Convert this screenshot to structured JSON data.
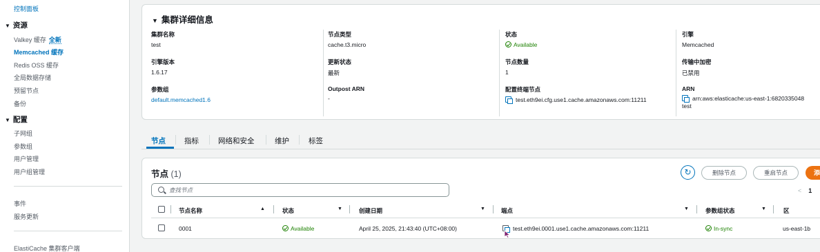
{
  "sidebar": {
    "top_link": "控制面板",
    "resources_header": "资源",
    "resource_items": [
      {
        "label": "Valkey 缓存",
        "badge": "全新"
      },
      {
        "label": "Memcached 缓存"
      },
      {
        "label": "Redis OSS 缓存"
      },
      {
        "label": "全局数据存储"
      },
      {
        "label": "预留节点"
      },
      {
        "label": "备份"
      }
    ],
    "config_header": "配置",
    "config_items": [
      "子网组",
      "参数组",
      "用户管理",
      "用户组管理"
    ],
    "other_items": [
      "事件",
      "服务更新"
    ],
    "footer_item": "ElastiCache 集群客户端"
  },
  "details": {
    "title": "集群详细信息",
    "fields": {
      "cluster_name": {
        "label": "集群名称",
        "value": "test"
      },
      "node_type": {
        "label": "节点类型",
        "value": "cache.t3.micro"
      },
      "status": {
        "label": "状态",
        "value": "Available"
      },
      "engine": {
        "label": "引擎",
        "value": "Memcached"
      },
      "engine_version": {
        "label": "引擎版本",
        "value": "1.6.17"
      },
      "update_status": {
        "label": "更新状态",
        "value": "最新"
      },
      "node_count": {
        "label": "节点数量",
        "value": "1"
      },
      "encryption": {
        "label": "传输中加密",
        "value": "已禁用"
      },
      "param_group": {
        "label": "参数组",
        "value": "default.memcached1.6"
      },
      "outpost_arn": {
        "label": "Outpost ARN",
        "value": "-"
      },
      "config_endpoint": {
        "label": "配置终端节点",
        "value": "test.eth9ei.cfg.use1.cache.amazonaws.com:11211"
      },
      "arn": {
        "label": "ARN",
        "value": "arn:aws:elasticache:us-east-1:6820335048",
        "value2": "test"
      }
    }
  },
  "tabs": [
    "节点",
    "指标",
    "网络和安全",
    "维护",
    "标签"
  ],
  "nodes": {
    "title": "节点",
    "count": "(1)",
    "delete_button": "删除节点",
    "reboot_button": "重启节点",
    "add_button": "添加",
    "search_placeholder": "查找节点",
    "page": "1",
    "columns": [
      "节点名称",
      "状态",
      "创建日期",
      "端点",
      "参数组状态",
      "区"
    ],
    "rows": [
      {
        "name": "0001",
        "status": "Available",
        "created": "April 25, 2025, 21:43:40 (UTC+08:00)",
        "endpoint": "test.eth9ei.0001.use1.cache.amazonaws.com:11211",
        "param_status": "In-sync",
        "zone": "us-east-1b"
      }
    ]
  }
}
